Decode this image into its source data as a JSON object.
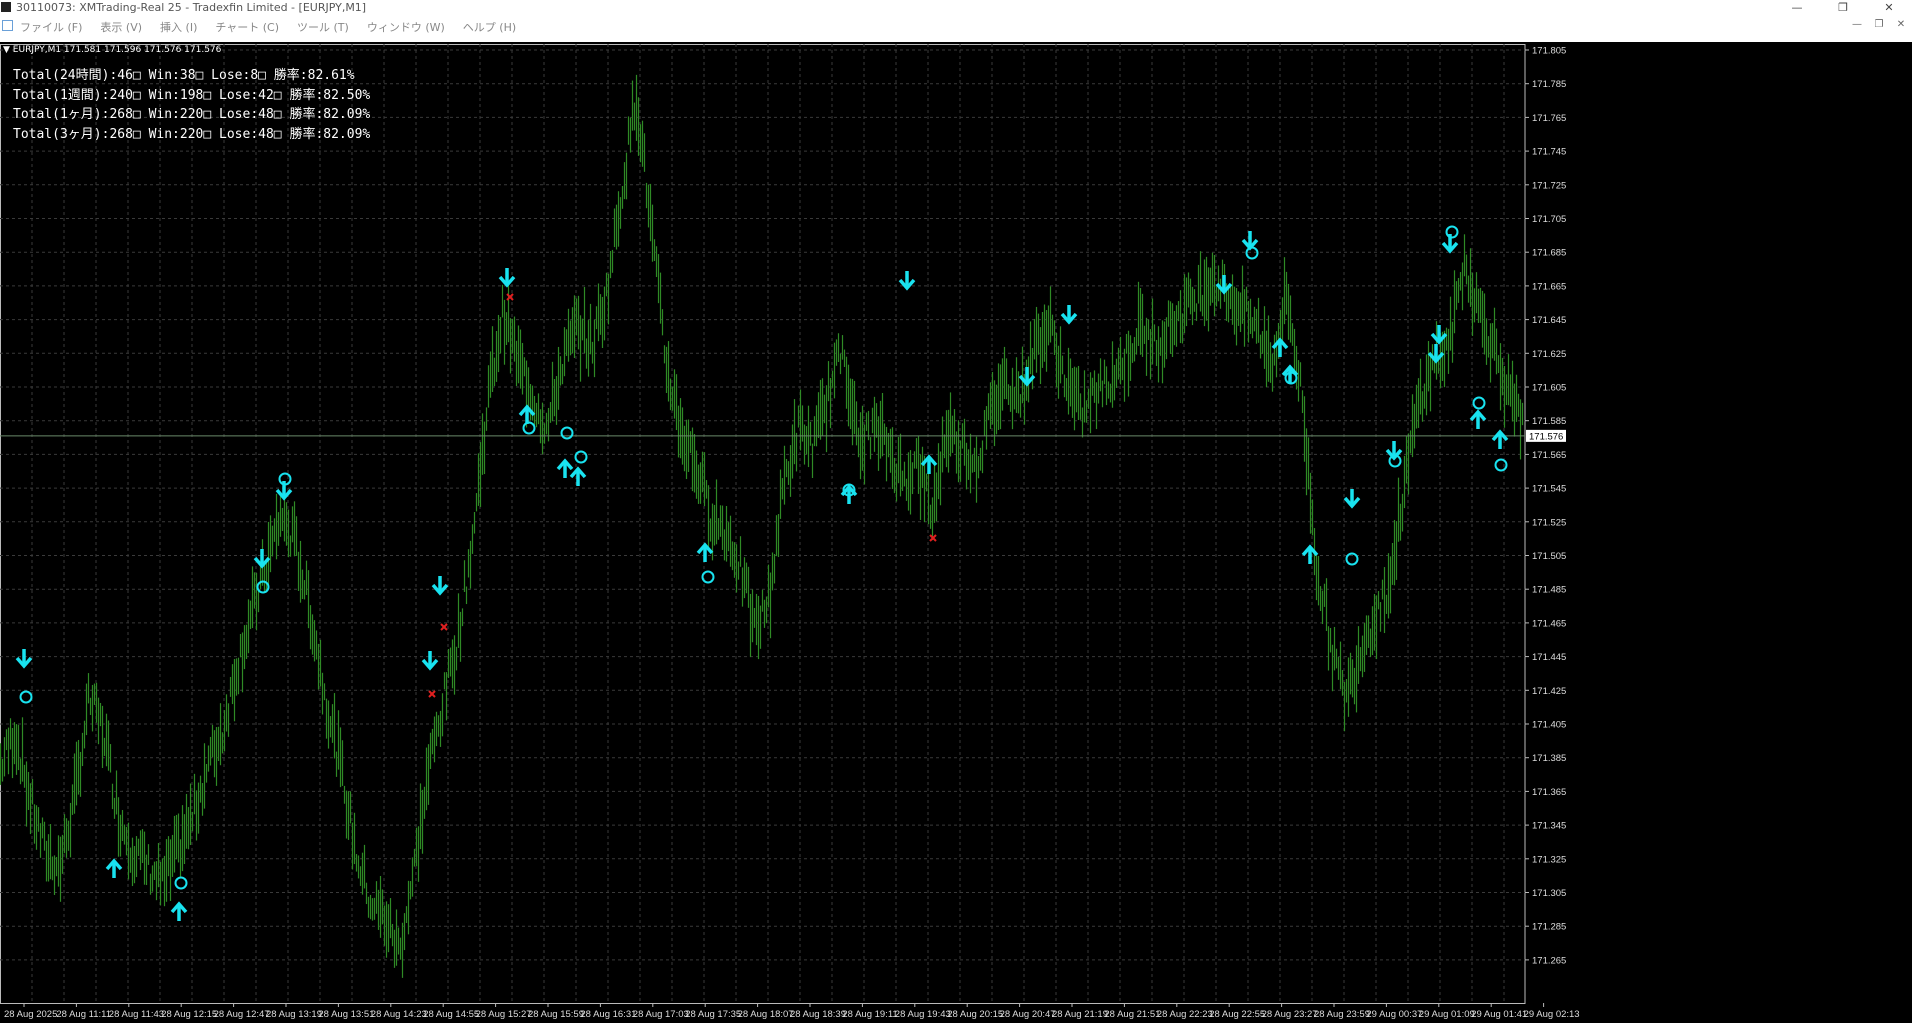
{
  "window": {
    "title": "30110073: XMTrading-Real 25 - Tradexfin Limited - [EURJPY,M1]",
    "controls": [
      "—",
      "❐",
      "✕"
    ]
  },
  "menu": {
    "items": [
      "ファイル (F)",
      "表示 (V)",
      "挿入 (I)",
      "チャート (C)",
      "ツール (T)",
      "ウィンドウ (W)",
      "ヘルプ (H)"
    ],
    "mdi_controls": [
      "—",
      "❐",
      "✕"
    ]
  },
  "chart": {
    "symbol_line": "EURJPY,M1  171.581 171.596 171.576 171.576",
    "current_price": "171.576",
    "price_labels": [
      "171.805",
      "171.785",
      "171.765",
      "171.745",
      "171.725",
      "171.705",
      "171.685",
      "171.665",
      "171.645",
      "171.625",
      "171.605",
      "171.585",
      "171.565",
      "171.545",
      "171.525",
      "171.505",
      "171.485",
      "171.465",
      "171.445",
      "171.425",
      "171.405",
      "171.385",
      "171.365",
      "171.345",
      "171.325",
      "171.305",
      "171.285",
      "171.265"
    ],
    "time_labels": [
      "28 Aug 2025",
      "28 Aug 11:11",
      "28 Aug 11:43",
      "28 Aug 12:15",
      "28 Aug 12:47",
      "28 Aug 13:19",
      "28 Aug 13:51",
      "28 Aug 14:23",
      "28 Aug 14:55",
      "28 Aug 15:27",
      "28 Aug 15:59",
      "28 Aug 16:31",
      "28 Aug 17:03",
      "28 Aug 17:35",
      "28 Aug 18:07",
      "28 Aug 18:39",
      "28 Aug 19:11",
      "28 Aug 19:43",
      "28 Aug 20:15",
      "28 Aug 20:47",
      "28 Aug 21:19",
      "28 Aug 21:51",
      "28 Aug 22:23",
      "28 Aug 22:55",
      "28 Aug 23:27",
      "28 Aug 23:59",
      "29 Aug 00:37",
      "29 Aug 01:09",
      "29 Aug 01:41",
      "29 Aug 02:13"
    ],
    "colors": {
      "bars": "#2f8a25",
      "grid": "#3a3a3a",
      "signal": "#19e3f0",
      "lose_mark": "#e02020",
      "current_line": "#6a8a6a"
    },
    "stats": [
      "Total(24時間):46□  Win:38□  Lose:8□  勝率:82.61%",
      "Total(1週間):240□  Win:198□  Lose:42□  勝率:82.50%",
      "Total(1ヶ月):268□  Win:220□  Lose:48□  勝率:82.09%",
      "Total(3ヶ月):268□  Win:220□  Lose:48□  勝率:82.09%"
    ]
  },
  "chart_data": {
    "type": "bar",
    "series": [
      {
        "values": [
          171.38,
          171.4,
          171.36,
          171.33,
          171.32,
          171.36,
          171.42,
          171.4,
          171.35,
          171.33,
          171.32,
          171.31,
          171.33,
          171.35,
          171.38,
          171.4,
          171.44,
          171.47,
          171.5,
          171.53,
          171.51,
          171.47,
          171.42,
          171.38,
          171.33,
          171.3,
          171.29,
          171.27,
          171.32,
          171.38,
          171.42,
          171.46,
          171.52,
          171.6,
          171.65,
          171.62,
          171.6,
          171.58,
          171.62,
          171.64,
          171.63,
          171.66,
          171.72,
          171.78,
          171.7,
          171.62,
          171.58,
          171.56,
          171.53,
          171.52,
          171.5,
          171.46,
          171.48,
          171.55,
          171.58,
          171.57,
          171.6,
          171.63,
          171.57,
          171.58,
          171.57,
          171.55,
          171.56,
          171.53,
          171.58,
          171.57,
          171.56,
          171.59,
          171.61,
          171.6,
          171.63,
          171.64,
          171.61,
          171.59,
          171.6,
          171.61,
          171.62,
          171.64,
          171.63,
          171.64,
          171.65,
          171.66,
          171.67,
          171.66,
          171.65,
          171.64,
          171.62,
          171.66,
          171.6,
          171.5,
          171.45,
          171.42,
          171.45,
          171.47,
          171.49,
          171.55,
          171.6,
          171.62,
          171.63,
          171.68,
          171.65,
          171.63,
          171.6,
          171.58
        ]
      }
    ]
  },
  "signals": {
    "down": [
      [
        24,
        658
      ],
      [
        262,
        558
      ],
      [
        284,
        490
      ],
      [
        440,
        585
      ],
      [
        430,
        660
      ],
      [
        507,
        277
      ],
      [
        907,
        280
      ],
      [
        1069,
        314
      ],
      [
        1250,
        240
      ],
      [
        1224,
        284
      ],
      [
        1027,
        376
      ],
      [
        1352,
        498
      ],
      [
        1394,
        450
      ],
      [
        1450,
        243
      ],
      [
        1439,
        334
      ],
      [
        1436,
        353
      ]
    ],
    "up": [
      [
        114,
        869
      ],
      [
        179,
        912
      ],
      [
        527,
        415
      ],
      [
        565,
        469
      ],
      [
        578,
        477
      ],
      [
        705,
        553
      ],
      [
        849,
        495
      ],
      [
        929,
        465
      ],
      [
        1310,
        555
      ],
      [
        1280,
        348
      ],
      [
        1290,
        375
      ],
      [
        1478,
        420
      ],
      [
        1500,
        440
      ]
    ],
    "circles": [
      [
        26,
        697
      ],
      [
        181,
        883
      ],
      [
        263,
        587
      ],
      [
        285,
        479
      ],
      [
        529,
        428
      ],
      [
        567,
        433
      ],
      [
        581,
        457
      ],
      [
        708,
        577
      ],
      [
        849,
        490
      ],
      [
        1252,
        253
      ],
      [
        1352,
        559
      ],
      [
        1395,
        461
      ],
      [
        1452,
        232
      ],
      [
        1479,
        403
      ],
      [
        1501,
        465
      ],
      [
        1291,
        378
      ]
    ],
    "crosses": [
      [
        510,
        297
      ],
      [
        444,
        627
      ],
      [
        432,
        694
      ],
      [
        933,
        538
      ]
    ]
  }
}
